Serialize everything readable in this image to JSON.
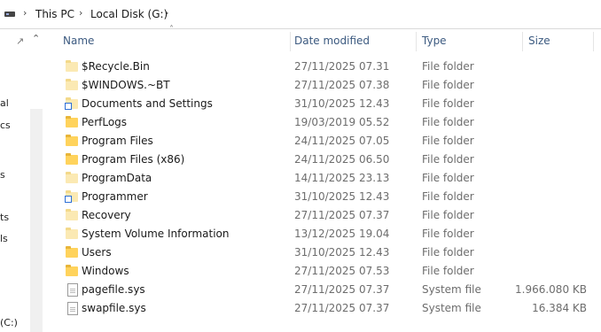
{
  "address": {
    "crumbs": [
      "This PC",
      "Local Disk (G:)"
    ]
  },
  "nav": {
    "fragments": [
      "al",
      "cs",
      "s",
      "ts",
      "ls",
      "(C:)"
    ]
  },
  "columns": {
    "name": "Name",
    "date": "Date modified",
    "type": "Type",
    "size": "Size"
  },
  "files": [
    {
      "name": "$Recycle.Bin",
      "date": "27/11/2025 07.31",
      "type": "File folder",
      "size": "",
      "icon": "folder-pale-icon"
    },
    {
      "name": "$WINDOWS.~BT",
      "date": "27/11/2025 07.38",
      "type": "File folder",
      "size": "",
      "icon": "folder-pale-icon"
    },
    {
      "name": "Documents and Settings",
      "date": "31/10/2025 12.43",
      "type": "File folder",
      "size": "",
      "icon": "folder-shortcut-icon"
    },
    {
      "name": "PerfLogs",
      "date": "19/03/2019 05.52",
      "type": "File folder",
      "size": "",
      "icon": "folder-icon"
    },
    {
      "name": "Program Files",
      "date": "24/11/2025 07.05",
      "type": "File folder",
      "size": "",
      "icon": "folder-icon"
    },
    {
      "name": "Program Files (x86)",
      "date": "24/11/2025 06.50",
      "type": "File folder",
      "size": "",
      "icon": "folder-icon"
    },
    {
      "name": "ProgramData",
      "date": "14/11/2025 23.13",
      "type": "File folder",
      "size": "",
      "icon": "folder-pale-icon"
    },
    {
      "name": "Programmer",
      "date": "31/10/2025 12.43",
      "type": "File folder",
      "size": "",
      "icon": "folder-shortcut-icon"
    },
    {
      "name": "Recovery",
      "date": "27/11/2025 07.37",
      "type": "File folder",
      "size": "",
      "icon": "folder-pale-icon"
    },
    {
      "name": "System Volume Information",
      "date": "13/12/2025 19.04",
      "type": "File folder",
      "size": "",
      "icon": "folder-pale-icon"
    },
    {
      "name": "Users",
      "date": "31/10/2025 12.43",
      "type": "File folder",
      "size": "",
      "icon": "folder-icon"
    },
    {
      "name": "Windows",
      "date": "27/11/2025 07.53",
      "type": "File folder",
      "size": "",
      "icon": "folder-icon"
    },
    {
      "name": "pagefile.sys",
      "date": "27/11/2025 07.37",
      "type": "System file",
      "size": "1.966.080 KB",
      "icon": "system-file-icon"
    },
    {
      "name": "swapfile.sys",
      "date": "27/11/2025 07.37",
      "type": "System file",
      "size": "16.384 KB",
      "icon": "system-file-icon"
    }
  ]
}
